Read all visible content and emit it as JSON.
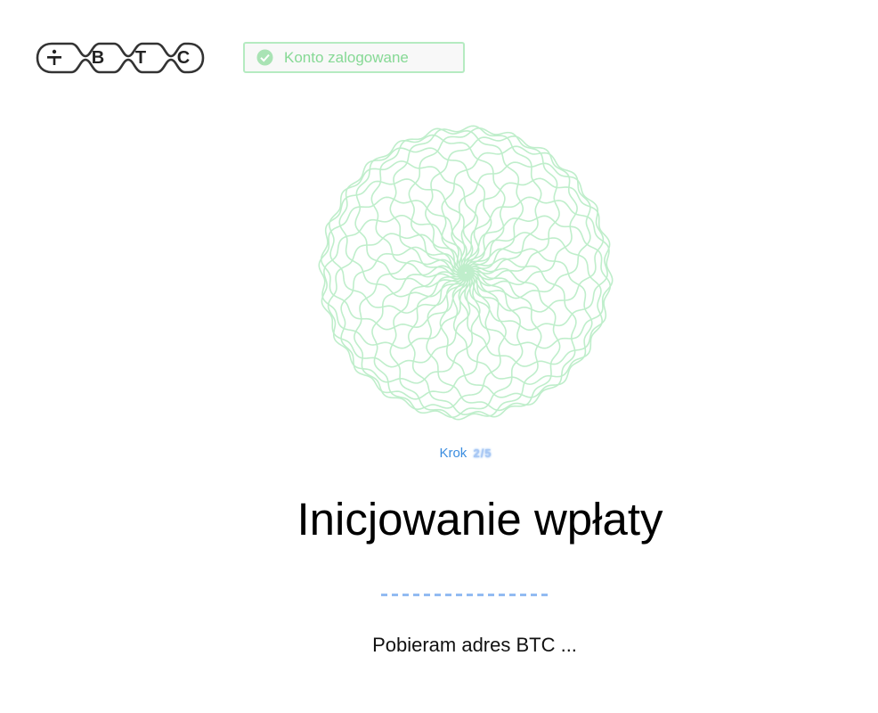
{
  "logo": {
    "letters": [
      "B",
      "T",
      "C"
    ],
    "icon": "divide-icon"
  },
  "status": {
    "text": "Konto zalogowane",
    "icon": "check-circle-icon",
    "color": "#86d995",
    "border_color": "#b5ebc1"
  },
  "spinner": {
    "icon": "spirograph-loading-graphic",
    "color": "#bfeecb"
  },
  "step": {
    "label": "Krok",
    "value": "2/5"
  },
  "title": "Inicjowanie wpłaty",
  "progress_icon": "dashed-loading-bar",
  "subtitle": "Pobieram adres BTC ...",
  "colors": {
    "accent_blue": "#3b8de0",
    "success_green": "#86d995"
  }
}
